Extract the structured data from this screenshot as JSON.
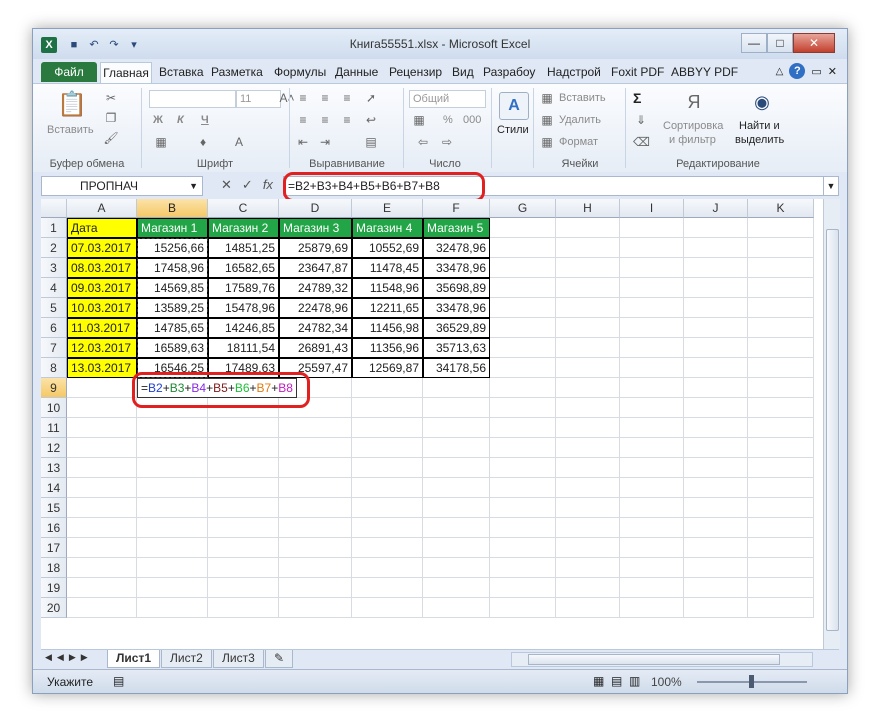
{
  "window": {
    "title": "Книга55551.xlsx - Microsoft Excel",
    "min": "—",
    "max": "□",
    "close": "✕"
  },
  "ribbon_tabs": [
    "Файл",
    "Главная",
    "Вставка",
    "Разметка",
    "Формулы",
    "Данные",
    "Рецензир",
    "Вид",
    "Разрабоу",
    "Надстрой",
    "Foxit PDF",
    "ABBYY PDF"
  ],
  "ribbon": {
    "clipboard": {
      "label": "Буфер обмена",
      "paste": "Вставить"
    },
    "font": {
      "label": "Шрифт",
      "size": "11",
      "bold": "Ж",
      "italic": "К",
      "underline": "Ч"
    },
    "alignment": {
      "label": "Выравнивание"
    },
    "number": {
      "label": "Число",
      "format": "Общий",
      "pct": "%",
      "thousands": "000"
    },
    "styles": {
      "label": "Стили"
    },
    "cells": {
      "label": "Ячейки",
      "insert": "Вставить",
      "delete": "Удалить",
      "format": "Формат"
    },
    "editing": {
      "label": "Редактирование",
      "sort1": "Сортировка",
      "sort2": "и фильтр",
      "find1": "Найти и",
      "find2": "выделить",
      "sigma": "Σ"
    }
  },
  "formula_bar": {
    "name_box": "ПРОПНАЧ",
    "fx": "fx",
    "formula": "=B2+B3+B4+B5+B6+B7+B8"
  },
  "grid": {
    "columns": [
      "A",
      "B",
      "C",
      "D",
      "E",
      "F",
      "G",
      "H",
      "I",
      "J",
      "K"
    ],
    "rows": [
      "1",
      "2",
      "3",
      "4",
      "5",
      "6",
      "7",
      "8",
      "9",
      "10",
      "11",
      "12",
      "13",
      "14",
      "15",
      "16",
      "17",
      "18",
      "19",
      "20"
    ],
    "headers": [
      "Дата",
      "Магазин 1",
      "Магазин 2",
      "Магазин 3",
      "Магазин 4",
      "Магазин 5"
    ],
    "data": [
      [
        "07.03.2017",
        "15256,66",
        "14851,25",
        "25879,69",
        "10552,69",
        "32478,96"
      ],
      [
        "08.03.2017",
        "17458,96",
        "16582,65",
        "23647,87",
        "11478,45",
        "33478,96"
      ],
      [
        "09.03.2017",
        "14569,85",
        "17589,76",
        "24789,32",
        "11548,96",
        "35698,89"
      ],
      [
        "10.03.2017",
        "13589,25",
        "15478,96",
        "22478,96",
        "12211,65",
        "33478,96"
      ],
      [
        "11.03.2017",
        "14785,65",
        "14246,85",
        "24782,34",
        "11456,98",
        "36529,89"
      ],
      [
        "12.03.2017",
        "16589,63",
        "18111,54",
        "26891,43",
        "11356,96",
        "35713,63"
      ],
      [
        "13.03.2017",
        "16546,25",
        "17489,63",
        "25597,47",
        "12569,87",
        "34178,56"
      ]
    ],
    "active_formula_parts": [
      {
        "t": "=",
        "c": "#222222"
      },
      {
        "t": "B2",
        "c": "#1f3fd0"
      },
      {
        "t": "+",
        "c": "#222222"
      },
      {
        "t": "B3",
        "c": "#1e8a33"
      },
      {
        "t": "+",
        "c": "#222222"
      },
      {
        "t": "B4",
        "c": "#8a2be2"
      },
      {
        "t": "+",
        "c": "#222222"
      },
      {
        "t": "B5",
        "c": "#7a1a1a"
      },
      {
        "t": "+",
        "c": "#222222"
      },
      {
        "t": "B6",
        "c": "#1fbf3a"
      },
      {
        "t": "+",
        "c": "#222222"
      },
      {
        "t": "B7",
        "c": "#e07b12"
      },
      {
        "t": "+",
        "c": "#222222"
      },
      {
        "t": "B8",
        "c": "#c21ec2"
      }
    ]
  },
  "sheets": [
    "Лист1",
    "Лист2",
    "Лист3"
  ],
  "status": {
    "mode": "Укажите",
    "zoom": "100%"
  },
  "colors": {
    "header_green": "#21a546",
    "date_yellow": "#ffff00",
    "highlight_red": "#e12020"
  }
}
